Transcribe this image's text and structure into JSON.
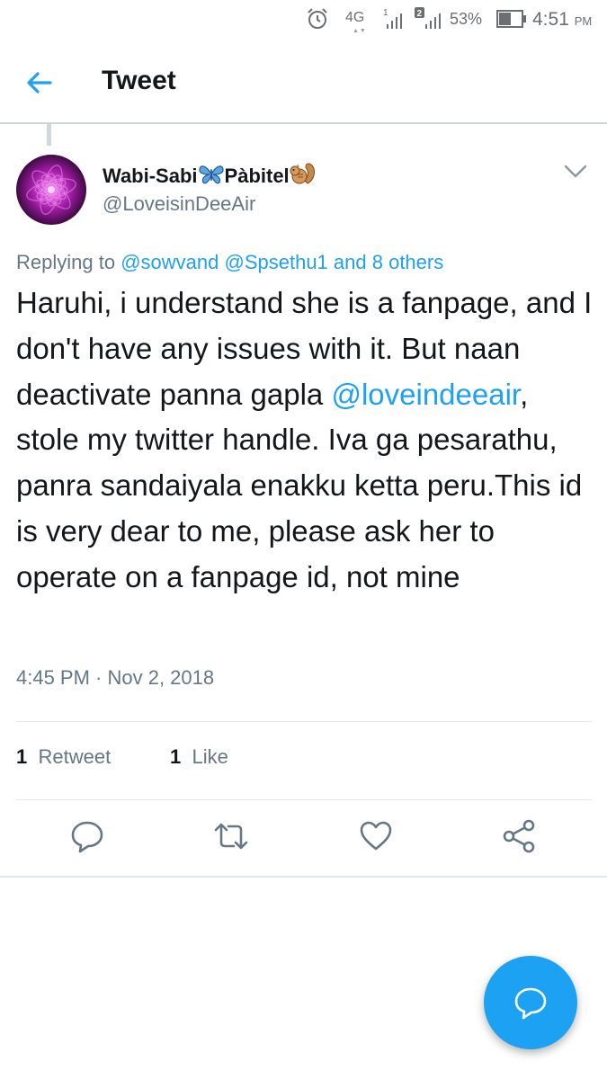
{
  "status_bar": {
    "network": "4G",
    "sim1_badge": "1",
    "sim2_badge": "2",
    "battery_percent": "53%",
    "time": "4:51",
    "ampm": "PM"
  },
  "header": {
    "title": "Tweet"
  },
  "tweet": {
    "author": {
      "name_part1": "Wabi-Sabi",
      "name_part2": "Pàbitel",
      "handle": "@LoveisinDeeAir"
    },
    "reply": {
      "prefix": "Replying to",
      "mention1": "@sowvand",
      "mention2": "@Spsethu1",
      "others": "and 8 others"
    },
    "text": {
      "before_mention": "Haruhi, i understand she is a fanpage, and I don't have any issues with it. But naan deactivate panna gapla ",
      "mention": "@loveindeeair",
      "after_mention": ", stole my twitter handle. Iva ga pesarathu, panra sandaiyala enakku ketta peru.This id is very dear to me, please ask her to operate on a fanpage id, not mine"
    },
    "timestamp": "4:45 PM · Nov 2, 2018",
    "stats": {
      "retweets_count": "1",
      "retweets_label": "Retweet",
      "likes_count": "1",
      "likes_label": "Like"
    }
  },
  "colors": {
    "accent": "#1da1f2",
    "secondary_text": "#657786"
  },
  "icons": [
    "back-arrow-icon",
    "chevron-down-icon",
    "reply-icon",
    "retweet-icon",
    "like-icon",
    "share-icon",
    "compose-reply-icon",
    "alarm-icon",
    "signal-icon",
    "battery-icon"
  ]
}
